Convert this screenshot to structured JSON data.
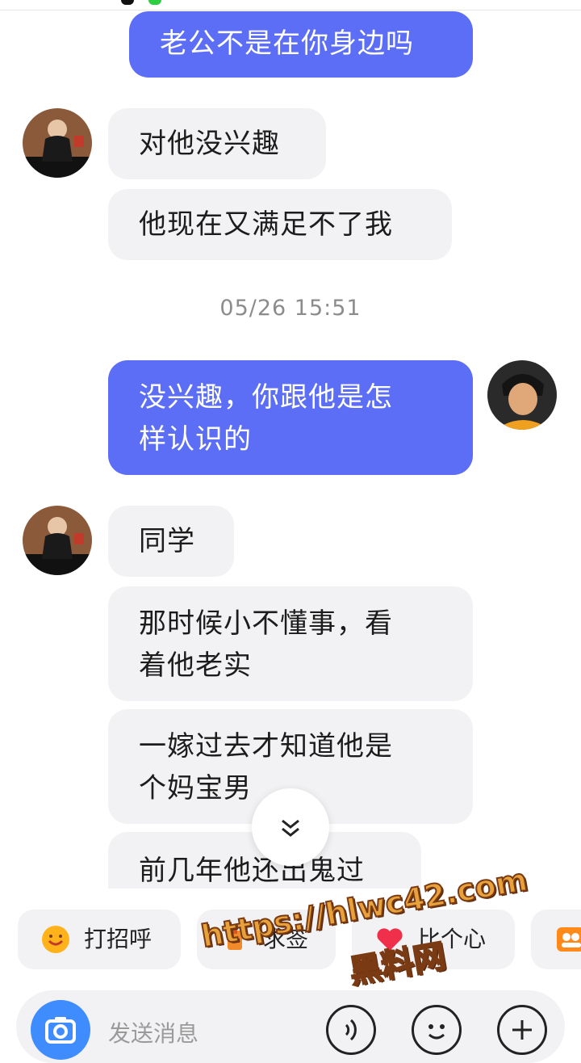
{
  "messages": [
    {
      "id": "m1",
      "side": "out",
      "lines": [
        "老公不是在你身边吗"
      ]
    },
    {
      "id": "m2",
      "side": "in",
      "lines": [
        "对他没兴趣"
      ]
    },
    {
      "id": "m3",
      "side": "in",
      "lines": [
        "他现在又满足不了我"
      ]
    },
    {
      "id": "m4",
      "side": "out",
      "lines": [
        "没兴趣，你跟他是怎",
        "样认识的"
      ]
    },
    {
      "id": "m5",
      "side": "in",
      "lines": [
        "同学"
      ]
    },
    {
      "id": "m6",
      "side": "in",
      "lines": [
        "那时候小不懂事，看",
        "着他老实"
      ]
    },
    {
      "id": "m7",
      "side": "in",
      "lines": [
        "一嫁过去才知道他是",
        "个妈宝男"
      ]
    },
    {
      "id": "m8",
      "side": "in",
      "lines": [
        "前几年他还出鬼过"
      ]
    }
  ],
  "timestamp": "05/26 15:51",
  "quick_actions": [
    {
      "label": "打招呼",
      "icon": "smile-wave-icon"
    },
    {
      "label": "求签",
      "icon": "fortune-icon"
    },
    {
      "label": "比个心",
      "icon": "heart-icon"
    },
    {
      "label": "",
      "icon": "group-icon"
    }
  ],
  "input": {
    "placeholder": "发送消息"
  },
  "watermark": {
    "url": "https://hlwc42.com",
    "name": "黑料网"
  },
  "colors": {
    "accent": "#5b6ef5",
    "incoming": "#f2f2f4",
    "camera": "#3f8cff"
  }
}
